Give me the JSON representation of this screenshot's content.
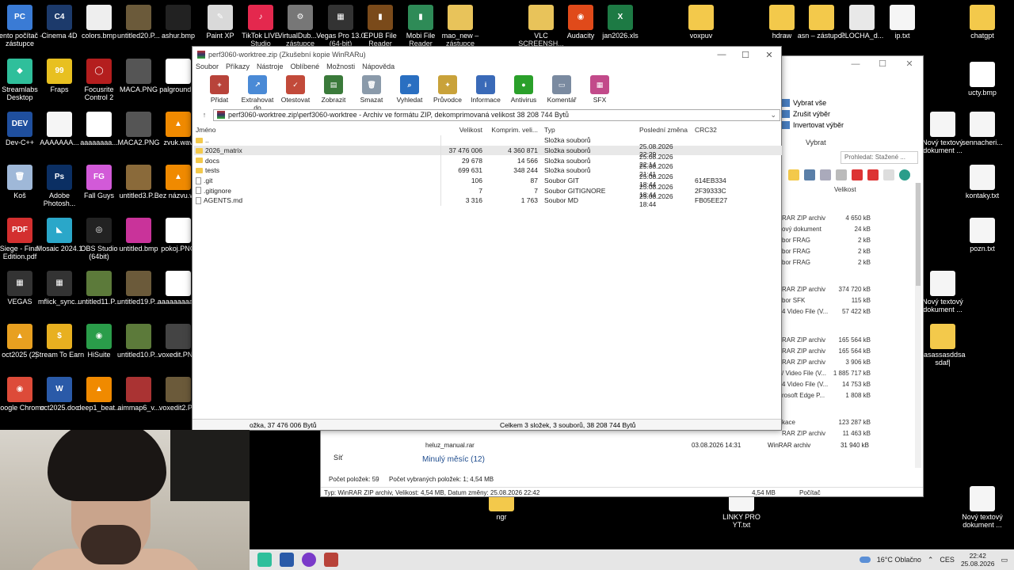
{
  "desktop": {
    "icons": [
      {
        "label": "Tento počítač – zástupce",
        "color": "#3a7bd5",
        "glyph": "PC"
      },
      {
        "label": "Cinema 4D",
        "color": "#1c3a6b",
        "glyph": "C4"
      },
      {
        "label": "colors.bmp",
        "color": "#eeeeee",
        "glyph": ""
      },
      {
        "label": "untitled20.P...",
        "color": "#6b5a3a",
        "glyph": ""
      },
      {
        "label": "ashur.bmp",
        "color": "#222222",
        "glyph": ""
      },
      {
        "label": "Paint XP",
        "color": "#d9d9d9",
        "glyph": "✎"
      },
      {
        "label": "TikTok LIVE Studio",
        "color": "#e4284e",
        "glyph": "♪"
      },
      {
        "label": "VirtualDub... – zástupce",
        "color": "#777777",
        "glyph": "⚙"
      },
      {
        "label": "Vegas Pro 13.0 (64-bit)",
        "color": "#333333",
        "glyph": "▦"
      },
      {
        "label": "EPUB File Reader",
        "color": "#7a4a1a",
        "glyph": "▮"
      },
      {
        "label": "Mobi File Reader",
        "color": "#2e8b57",
        "glyph": "▮"
      },
      {
        "label": "mao_new – zástupce",
        "color": "#e8c35a",
        "glyph": ""
      },
      {
        "label": "VLC SCREENSH...",
        "color": "#e8c35a",
        "glyph": ""
      },
      {
        "label": "Audacity",
        "color": "#e04a1a",
        "glyph": "◉"
      },
      {
        "label": "jan2026.xls",
        "color": "#1d7a44",
        "glyph": "X"
      },
      {
        "label": "voxpuv",
        "color": "#f3c94b",
        "glyph": ""
      },
      {
        "label": "hdraw",
        "color": "#f3c94b",
        "glyph": ""
      },
      {
        "label": "asn – zástupce",
        "color": "#f3c94b",
        "glyph": ""
      },
      {
        "label": "PLOCHA_d...",
        "color": "#e8e8e8",
        "glyph": ""
      },
      {
        "label": "ip.txt",
        "color": "#f5f5f5",
        "glyph": ""
      },
      {
        "label": "chatgpt",
        "color": "#f3c94b",
        "glyph": ""
      },
      {
        "label": "Streamlabs Desktop",
        "color": "#2fbf9b",
        "glyph": "◆"
      },
      {
        "label": "Fraps",
        "color": "#e8c020",
        "glyph": "99"
      },
      {
        "label": "Focusrite Control 2",
        "color": "#b41e1e",
        "glyph": "◯"
      },
      {
        "label": "MACA.PNG",
        "color": "#555555",
        "glyph": ""
      },
      {
        "label": "palground...",
        "color": "#ffffff",
        "glyph": ""
      },
      {
        "label": "Dev-C++",
        "color": "#1f4f9e",
        "glyph": "DEV"
      },
      {
        "label": "AAAAAAA...",
        "color": "#f5f5f5",
        "glyph": ""
      },
      {
        "label": "aaaaaaaa...",
        "color": "#ffffff",
        "glyph": ""
      },
      {
        "label": "MACA2.PNG",
        "color": "#555555",
        "glyph": ""
      },
      {
        "label": "zvuk.wav",
        "color": "#f08a00",
        "glyph": "▲"
      },
      {
        "label": "Koš",
        "color": "#9fb8d8",
        "glyph": "🗑"
      },
      {
        "label": "Adobe Photosh...",
        "color": "#0b2f63",
        "glyph": "Ps"
      },
      {
        "label": "Fall Guys",
        "color": "#d25ad8",
        "glyph": "FG"
      },
      {
        "label": "untitled3.P...",
        "color": "#8a6a3a",
        "glyph": ""
      },
      {
        "label": "Bez názvu.wav",
        "color": "#f08a00",
        "glyph": "▲"
      },
      {
        "label": "Siege - Final Edition.pdf",
        "color": "#d32f2f",
        "glyph": "PDF"
      },
      {
        "label": "Mosaic 2024.1",
        "color": "#2aa7c9",
        "glyph": "◣"
      },
      {
        "label": "OBS Studio (64bit)",
        "color": "#222222",
        "glyph": "◎"
      },
      {
        "label": "untitled.bmp",
        "color": "#c9339a",
        "glyph": ""
      },
      {
        "label": "pokoj.PNG",
        "color": "#ffffff",
        "glyph": ""
      },
      {
        "label": "VEGAS",
        "color": "#333333",
        "glyph": "▦"
      },
      {
        "label": "mflick_sync...",
        "color": "#333333",
        "glyph": "▦"
      },
      {
        "label": "untitled11.P...",
        "color": "#5c7a3a",
        "glyph": ""
      },
      {
        "label": "untitled19.P...",
        "color": "#6b5a3a",
        "glyph": ""
      },
      {
        "label": "aaaaaaaaa...",
        "color": "#ffffff",
        "glyph": ""
      },
      {
        "label": "oct2025 (2)",
        "color": "#e8a020",
        "glyph": "▲"
      },
      {
        "label": "Stream To Earn",
        "color": "#e8b020",
        "glyph": "$"
      },
      {
        "label": "HiSuite",
        "color": "#2a9d4a",
        "glyph": "◉"
      },
      {
        "label": "untitled10.P...",
        "color": "#5c7a3a",
        "glyph": ""
      },
      {
        "label": "voxedit.PNG",
        "color": "#444444",
        "glyph": ""
      },
      {
        "label": "Google Chrome",
        "color": "#dd4b39",
        "glyph": "◉"
      },
      {
        "label": "oct2025.doc",
        "color": "#2a5aa8",
        "glyph": "W"
      },
      {
        "label": "deep1_beat...",
        "color": "#f08a00",
        "glyph": "▲"
      },
      {
        "label": "aimmap6_v...",
        "color": "#a33",
        "glyph": ""
      },
      {
        "label": "voxedit2.P...",
        "color": "#6b5a3a",
        "glyph": ""
      },
      {
        "label": "ucty.bmp",
        "color": "#ffffff",
        "glyph": ""
      },
      {
        "label": "Nový textový dokument ...",
        "color": "#f5f5f5",
        "glyph": ""
      },
      {
        "label": "sennacheri...",
        "color": "#f5f5f5",
        "glyph": ""
      },
      {
        "label": "kontaky.txt",
        "color": "#f5f5f5",
        "glyph": ""
      },
      {
        "label": "pozn.txt",
        "color": "#f5f5f5",
        "glyph": ""
      },
      {
        "label": "Nový textový dokument ...",
        "color": "#f5f5f5",
        "glyph": ""
      },
      {
        "label": "sasassasddsa sdaf|",
        "color": "#f3c94b",
        "glyph": ""
      },
      {
        "label": "ngr",
        "color": "#f3c94b",
        "glyph": ""
      },
      {
        "label": "LINKY PRO YT.txt",
        "color": "#f5f5f5",
        "glyph": ""
      },
      {
        "label": "Nový textový dokument ...",
        "color": "#f5f5f5",
        "glyph": ""
      }
    ]
  },
  "explorer": {
    "ribbon": {
      "select_all": "Vybrat vše",
      "select_none": "Zrušit výběr",
      "invert": "Invertovat výběr",
      "group_label": "Vybrat"
    },
    "search_placeholder": "Prohledat: Stažené ...",
    "size_col": "Velikost",
    "rows": [
      {
        "type": "RAR ZIP archiv",
        "size": "4 650 kB"
      },
      {
        "type": "ový dokument",
        "size": "24 kB"
      },
      {
        "type": "bor FRAG",
        "size": "2 kB"
      },
      {
        "type": "bor FRAG",
        "size": "2 kB"
      },
      {
        "type": "bor FRAG",
        "size": "2 kB"
      },
      {
        "type": "RAR ZIP archiv",
        "size": "374 720 kB"
      },
      {
        "type": "bor SFK",
        "size": "115 kB"
      },
      {
        "type": "4 Video File (V...",
        "size": "57 422 kB"
      },
      {
        "type": "RAR ZIP archiv",
        "size": "165 564 kB"
      },
      {
        "type": "RAR ZIP archiv",
        "size": "165 564 kB"
      },
      {
        "type": "RAR ZIP archiv",
        "size": "3 906 kB"
      },
      {
        "type": "/ Video File (V...",
        "size": "1 885 717 kB"
      },
      {
        "type": "4 Video File (V...",
        "size": "14 753 kB"
      },
      {
        "type": "rosoft Edge P...",
        "size": "1 808 kB"
      },
      {
        "type": "kace",
        "size": "123 287 kB"
      },
      {
        "type": "RAR ZIP archiv",
        "size": "11 463 kB"
      }
    ],
    "heluz": {
      "name": "heluz_manual.rar",
      "date": "03.08.2026 14:31",
      "type": "WinRAR archiv",
      "size": "31 940 kB"
    },
    "group_label": "Minulý měsíc (12)",
    "network": "Síť",
    "items_count": "Počet položek: 59",
    "selected_count": "Počet vybraných položek: 1; 4,54 MB",
    "bottom_info": "Typ: WinRAR ZIP archiv, Velikost: 4,54 MB, Datum změny: 25.08.2026 22:42",
    "bottom_size": "4,54 MB",
    "bottom_pc": "Počítač"
  },
  "winrar": {
    "title": "perf3060-worktree.zip (Zkušební kopie WinRARu)",
    "menu": [
      "Soubor",
      "Příkazy",
      "Nástroje",
      "Oblíbené",
      "Možnosti",
      "Nápověda"
    ],
    "toolbar": [
      {
        "label": "Přidat",
        "color": "#b8433a",
        "glyph": "+"
      },
      {
        "label": "Extrahovat do",
        "color": "#4a8ad6",
        "glyph": "↗"
      },
      {
        "label": "Otestovat",
        "color": "#c24a3a",
        "glyph": "✓"
      },
      {
        "label": "Zobrazit",
        "color": "#3a7a3a",
        "glyph": "▤"
      },
      {
        "label": "Smazat",
        "color": "#8a9aaa",
        "glyph": "🗑"
      },
      {
        "label": "Vyhledat",
        "color": "#2a6fc1",
        "glyph": "⌕"
      },
      {
        "label": "Průvodce",
        "color": "#c9a23a",
        "glyph": "✦"
      },
      {
        "label": "Informace",
        "color": "#3a6ab8",
        "glyph": "i"
      },
      {
        "label": "Antivirus",
        "color": "#2aa02a",
        "glyph": "●"
      },
      {
        "label": "Komentář",
        "color": "#7a8aa0",
        "glyph": "▭"
      },
      {
        "label": "SFX",
        "color": "#c24a8a",
        "glyph": "▦"
      }
    ],
    "path": "perf3060-worktree.zip\\perf3060-worktree - Archiv ve formátu ZIP, dekomprimovaná velikost 38 208 744 Bytů",
    "columns": {
      "name": "Jméno",
      "size": "Velikost",
      "packed": "Komprim. veli...",
      "type": "Typ",
      "modified": "Poslední změna",
      "crc": "CRC32"
    },
    "files": [
      {
        "name": "..",
        "size": "",
        "packed": "",
        "type": "Složka souborů",
        "modified": "",
        "crc": "",
        "kind": "folder"
      },
      {
        "name": "2026_matrix",
        "size": "37 476 006",
        "packed": "4 360 871",
        "type": "Složka souborů",
        "modified": "25.08.2026 22:29",
        "crc": "",
        "kind": "folder"
      },
      {
        "name": "docs",
        "size": "29 678",
        "packed": "14 566",
        "type": "Složka souborů",
        "modified": "25.08.2026 22:14",
        "crc": "",
        "kind": "folder"
      },
      {
        "name": "tests",
        "size": "699 631",
        "packed": "348 244",
        "type": "Složka souborů",
        "modified": "25.08.2026 21:41",
        "crc": "",
        "kind": "folder"
      },
      {
        "name": ".git",
        "size": "106",
        "packed": "87",
        "type": "Soubor GIT",
        "modified": "25.08.2026 18:44",
        "crc": "614EB334",
        "kind": "file"
      },
      {
        "name": ".gitignore",
        "size": "7",
        "packed": "7",
        "type": "Soubor GITIGNORE",
        "modified": "25.08.2026 18:44",
        "crc": "2F39333C",
        "kind": "file"
      },
      {
        "name": "AGENTS.md",
        "size": "3 316",
        "packed": "1 763",
        "type": "Soubor MD",
        "modified": "25.08.2026 18:44",
        "crc": "FB05EE27",
        "kind": "file"
      }
    ],
    "status_left": "ožka, 37 476 006 Bytů",
    "status_right": "Celkem 3 složek, 3 souborů, 38 208 744 Bytů"
  },
  "taskbar": {
    "weather": "16°C  Oblačno",
    "lang": "CES",
    "time": "22:42",
    "date": "25.08.2026"
  }
}
